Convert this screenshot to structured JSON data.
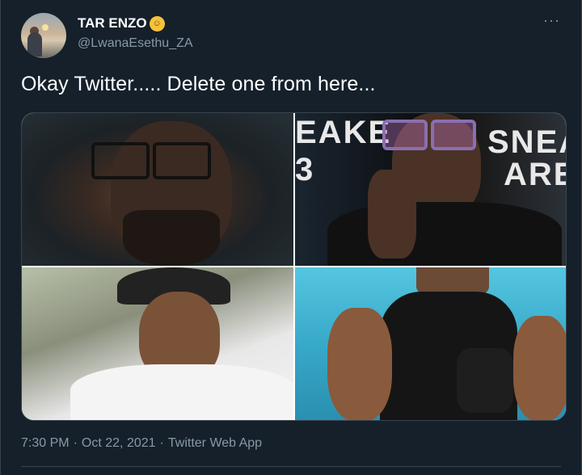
{
  "author": {
    "display_name": "TAR ENZO",
    "emoji": "☺",
    "handle": "@LwanaEsethu_ZA"
  },
  "more_menu": "···",
  "tweet": {
    "text": "Okay Twitter..... Delete one from here..."
  },
  "media": {
    "images": [
      {
        "name": "photo-1"
      },
      {
        "name": "photo-2",
        "wall_text_top": "EAKE",
        "wall_text_bottom": "3",
        "wall_text_right_top": "SNEA",
        "wall_text_right_bottom": "ARE"
      },
      {
        "name": "photo-3"
      },
      {
        "name": "photo-4"
      }
    ]
  },
  "meta": {
    "time": "7:30 PM",
    "separator": "·",
    "date": "Oct 22, 2021",
    "source": "Twitter Web App"
  },
  "colors": {
    "background": "#15202b",
    "secondary_text": "#8899a6",
    "border": "#38444d"
  }
}
